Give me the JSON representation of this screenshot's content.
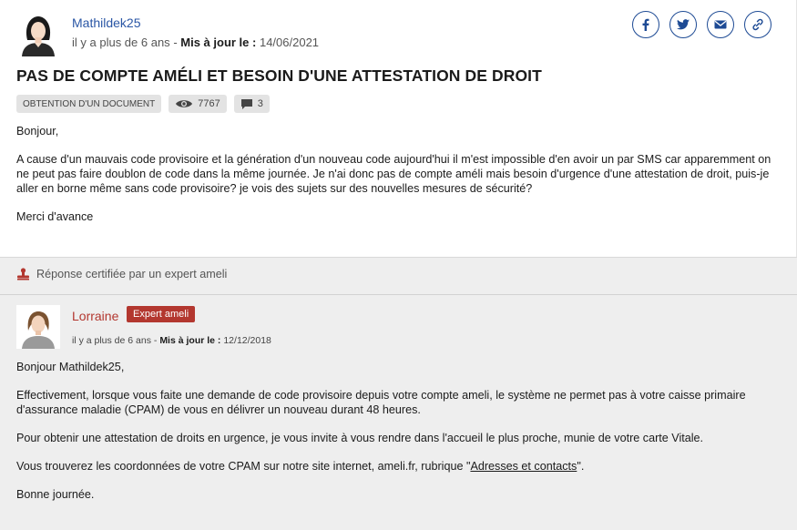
{
  "question": {
    "author": "Mathildek25",
    "age": "il y a plus de 6 ans",
    "updated_label": "Mis à jour le :",
    "updated_date": "14/06/2021",
    "title": "PAS DE COMPTE AMÉLI ET BESOIN D'UNE ATTESTATION DE DROIT",
    "tag": "Obtention d'un document",
    "views": "7767",
    "comments": "3",
    "greeting": "Bonjour,",
    "body": "A cause d'un mauvais code provisoire et la génération d'un nouveau code aujourd'hui il m'est impossible d'en avoir un par SMS car apparemment on ne peut pas faire doublon de code dans la même journée. Je n'ai donc pas de compte améli mais besoin d'urgence d'une attestation de droit, puis-je aller en borne même sans code provisoire? je vois des sujets sur des nouvelles mesures de sécurité?",
    "closing": "Merci d'avance"
  },
  "share": {
    "icons": [
      "facebook-icon",
      "twitter-icon",
      "email-icon",
      "link-icon"
    ],
    "color": "#1d4a94"
  },
  "answer": {
    "certified_text": "Réponse certifiée par un expert ameli",
    "author": "Lorraine",
    "badge": "Expert ameli",
    "age": "il y a plus de 6 ans",
    "updated_label": "Mis à jour le :",
    "updated_date": "12/12/2018",
    "greeting": "Bonjour Mathildek25,",
    "p1": "Effectivement, lorsque vous faite une demande de code provisoire depuis votre compte ameli, le système ne permet pas à votre caisse primaire d'assurance maladie (CPAM) de vous en délivrer un nouveau durant 48 heures.",
    "p2": "Pour obtenir une attestation de droits en urgence, je vous invite à vous rendre dans l'accueil le plus proche, munie de votre carte Vitale.",
    "p3_before": "Vous trouverez les coordonnées de votre CPAM sur notre site internet, ameli.fr, rubrique \"",
    "p3_link": "Adresses et contacts",
    "p3_after": "\".",
    "closing": "Bonne journée."
  },
  "colors": {
    "link_blue": "#2a56a5",
    "expert_red": "#b3372f",
    "band_gray": "#eeeeee"
  }
}
